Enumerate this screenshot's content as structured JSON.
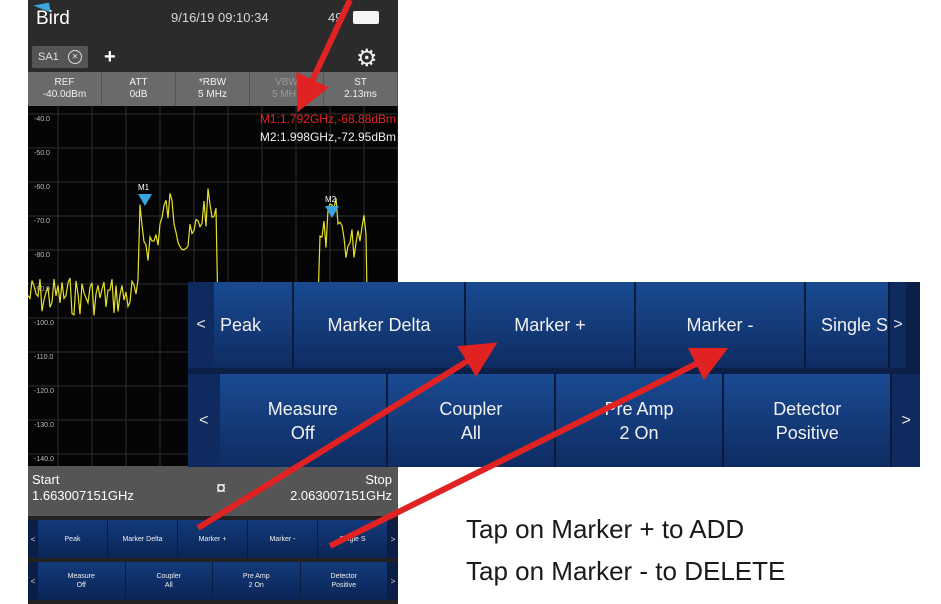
{
  "statusbar": {
    "app": "Bird",
    "datetime": "9/16/19 09:10:34",
    "battery": "49"
  },
  "tabs": {
    "active": "SA1",
    "add": "+"
  },
  "params": [
    {
      "label": "REF",
      "value": "-40.0dBm"
    },
    {
      "label": "ATT",
      "value": "0dB"
    },
    {
      "label": "*RBW",
      "value": "5 MHz"
    },
    {
      "label": "VBW",
      "value": "5 MHz"
    },
    {
      "label": "ST",
      "value": "2.13ms"
    }
  ],
  "markers": {
    "m1_readout": "M1:1.792GHz,-68.88dBm",
    "m2_readout": "M2:1.998GHz,-72.95dBm",
    "m1_label": "M1",
    "m2_label": "M2",
    "m1_color": "#3aa6e0",
    "m2_color": "#3aa6e0"
  },
  "plot": {
    "y_ticks": [
      "-40.0",
      "-50.0",
      "-60.0",
      "-70.0",
      "-80.0",
      "-90.0",
      "-100.0",
      "-110.0",
      "-120.0",
      "-130.0",
      "-140.0"
    ],
    "trace_color": "#e6e02a"
  },
  "freq": {
    "start_label": "Start",
    "start_value": "1.663007151GHz",
    "stop_label": "Stop",
    "stop_value": "2.063007151GHz"
  },
  "softkeys_a": {
    "prev": "<",
    "next": ">",
    "items": [
      "Peak",
      "Marker Delta",
      "Marker +",
      "Marker -",
      "Single S"
    ]
  },
  "softkeys_b": {
    "prev": "<",
    "next": ">",
    "items": [
      {
        "line1": "Measure",
        "line2": "Off"
      },
      {
        "line1": "Coupler",
        "line2": "All"
      },
      {
        "line1": "Pre Amp",
        "line2": "2 On"
      },
      {
        "line1": "Detector",
        "line2": "Positive"
      }
    ]
  },
  "zoom": {
    "row_a": {
      "prev": "<",
      "next": ">",
      "items": [
        "Peak",
        "Marker Delta",
        "Marker +",
        "Marker -",
        "Single S"
      ]
    },
    "row_b": {
      "prev": "<",
      "next": ">",
      "items": [
        {
          "line1": "Measure",
          "line2": "Off"
        },
        {
          "line1": "Coupler",
          "line2": "All"
        },
        {
          "line1": "Pre Amp",
          "line2": "2 On"
        },
        {
          "line1": "Detector",
          "line2": "Positive"
        }
      ]
    }
  },
  "captions": {
    "line1": "Tap on Marker + to ADD",
    "line2": "Tap on Marker - to DELETE"
  },
  "arrow_color": "#e02222"
}
